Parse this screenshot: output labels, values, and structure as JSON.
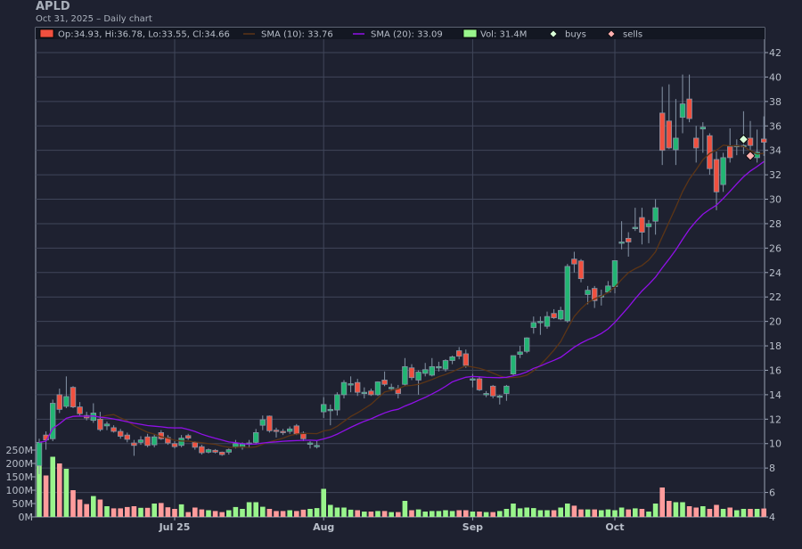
{
  "header": {
    "title": "APLD",
    "subtitle": "Oct 31, 2025 – Daily chart"
  },
  "legend": {
    "ohlc": "Op:34.93, Hi:36.78, Lo:33.55, Cl:34.66",
    "sma10": "SMA (10): 33.76",
    "sma20": "SMA (20): 33.09",
    "vol": "Vol: 31.4M",
    "buys": "buys",
    "sells": "sells"
  },
  "colors": {
    "up": "#22b573",
    "down": "#f0503f",
    "vol_up": "#99f58c",
    "vol_down": "#ff9c9c",
    "sma10": "#5c3516",
    "sma20": "#9010e8",
    "grid": "#40465a",
    "bg": "#1e2130",
    "buy": "#d9ffd9",
    "sell": "#ffb0b0"
  },
  "chart_data": {
    "type": "candlestick",
    "title": "APLD",
    "ylim": [
      4,
      42
    ],
    "y_ticks": [
      4,
      6,
      8,
      10,
      12,
      14,
      16,
      18,
      20,
      22,
      24,
      26,
      28,
      30,
      32,
      34,
      36,
      38,
      40,
      42
    ],
    "vol_ticks": [
      "0M",
      "50M",
      "100M",
      "150M",
      "200M",
      "250M"
    ],
    "vol_tick_values": [
      0,
      50,
      100,
      150,
      200,
      250
    ],
    "x_labels": [
      {
        "label": "Jul 25",
        "index": 20
      },
      {
        "label": "Aug",
        "index": 42
      },
      {
        "label": "Sep",
        "index": 64
      },
      {
        "label": "Oct",
        "index": 85
      }
    ],
    "sma_periods": [
      10,
      20
    ],
    "buys": [
      {
        "index": 104,
        "price": 34.9
      }
    ],
    "sells": [
      {
        "index": 105,
        "price": 33.55
      }
    ],
    "ohlcv": [
      [
        8.2,
        10.4,
        7.5,
        10.1,
        225
      ],
      [
        10.7,
        11.0,
        9.5,
        10.3,
        155
      ],
      [
        10.4,
        13.6,
        10.2,
        13.3,
        225
      ],
      [
        14.0,
        14.5,
        12.5,
        12.8,
        200
      ],
      [
        13.05,
        15.5,
        12.9,
        13.85,
        180
      ],
      [
        14.6,
        14.7,
        12.9,
        13.0,
        100
      ],
      [
        13.0,
        13.4,
        12.3,
        12.45,
        65
      ],
      [
        12.3,
        12.6,
        11.9,
        12.1,
        48
      ],
      [
        11.9,
        13.3,
        11.7,
        12.5,
        78
      ],
      [
        12.0,
        12.6,
        11.0,
        11.15,
        65
      ],
      [
        11.45,
        11.8,
        11.1,
        11.6,
        40
      ],
      [
        11.3,
        11.5,
        10.9,
        11.0,
        32
      ],
      [
        11.0,
        11.2,
        10.4,
        10.6,
        32
      ],
      [
        10.7,
        10.9,
        10.1,
        10.35,
        37
      ],
      [
        10.05,
        10.3,
        9.0,
        9.85,
        40
      ],
      [
        10.1,
        10.6,
        9.9,
        10.3,
        34
      ],
      [
        10.55,
        10.8,
        9.7,
        9.85,
        34
      ],
      [
        9.9,
        10.8,
        9.7,
        10.55,
        50
      ],
      [
        10.9,
        11.1,
        10.3,
        10.4,
        52
      ],
      [
        10.5,
        10.7,
        9.9,
        10.05,
        36
      ],
      [
        10.0,
        10.2,
        9.6,
        9.75,
        30
      ],
      [
        9.85,
        10.7,
        9.7,
        10.45,
        47
      ],
      [
        10.65,
        10.8,
        10.3,
        10.45,
        18
      ],
      [
        10.1,
        10.2,
        9.5,
        9.7,
        35
      ],
      [
        9.75,
        9.9,
        9.1,
        9.25,
        28
      ],
      [
        9.3,
        9.6,
        9.2,
        9.5,
        25
      ],
      [
        9.45,
        9.55,
        9.2,
        9.3,
        22
      ],
      [
        9.3,
        9.35,
        9.0,
        9.1,
        18
      ],
      [
        9.3,
        9.6,
        9.1,
        9.5,
        25
      ],
      [
        9.7,
        10.3,
        9.6,
        10.0,
        37
      ],
      [
        9.7,
        10.1,
        9.5,
        10.0,
        30
      ],
      [
        9.95,
        10.3,
        9.7,
        10.05,
        55
      ],
      [
        10.1,
        11.2,
        10.0,
        10.9,
        55
      ],
      [
        11.5,
        12.3,
        11.1,
        11.95,
        38
      ],
      [
        12.25,
        12.3,
        10.9,
        11.05,
        30
      ],
      [
        11.1,
        11.3,
        10.5,
        11.0,
        22
      ],
      [
        11.0,
        11.2,
        10.7,
        10.9,
        22
      ],
      [
        11.0,
        11.4,
        10.8,
        11.2,
        25
      ],
      [
        11.45,
        11.6,
        10.7,
        10.8,
        22
      ],
      [
        10.85,
        11.0,
        10.2,
        10.4,
        27
      ],
      [
        10.0,
        10.2,
        9.6,
        10.05,
        30
      ],
      [
        9.85,
        10.2,
        9.6,
        9.85,
        33
      ],
      [
        12.6,
        13.8,
        12.1,
        13.2,
        105
      ],
      [
        12.8,
        13.2,
        11.5,
        12.8,
        45
      ],
      [
        12.75,
        14.2,
        12.3,
        14.0,
        35
      ],
      [
        14.0,
        15.2,
        13.7,
        15.0,
        35
      ],
      [
        14.9,
        15.5,
        14.2,
        14.9,
        27
      ],
      [
        15.0,
        15.3,
        13.9,
        14.2,
        25
      ],
      [
        14.2,
        14.6,
        13.7,
        14.2,
        20
      ],
      [
        14.3,
        14.5,
        13.9,
        14.0,
        20
      ],
      [
        14.0,
        15.1,
        13.9,
        15.05,
        22
      ],
      [
        15.2,
        15.9,
        14.7,
        14.85,
        22
      ],
      [
        14.6,
        14.9,
        14.3,
        14.6,
        18
      ],
      [
        14.5,
        14.8,
        13.7,
        14.1,
        18
      ],
      [
        14.85,
        17.0,
        14.7,
        16.3,
        60
      ],
      [
        16.2,
        16.5,
        15.2,
        15.4,
        25
      ],
      [
        15.2,
        16.0,
        14.0,
        15.85,
        28
      ],
      [
        15.75,
        16.6,
        15.5,
        16.05,
        20
      ],
      [
        15.6,
        17.0,
        15.5,
        16.3,
        22
      ],
      [
        16.3,
        16.7,
        15.9,
        16.3,
        22
      ],
      [
        16.1,
        16.9,
        15.9,
        16.8,
        25
      ],
      [
        16.8,
        17.2,
        16.5,
        17.1,
        22
      ],
      [
        17.6,
        17.9,
        16.9,
        17.15,
        25
      ],
      [
        17.35,
        17.7,
        16.2,
        16.4,
        25
      ],
      [
        15.2,
        15.7,
        14.6,
        15.3,
        20
      ],
      [
        15.3,
        15.5,
        14.3,
        14.4,
        20
      ],
      [
        14.1,
        14.3,
        13.8,
        14.1,
        18
      ],
      [
        14.7,
        14.8,
        13.7,
        13.9,
        18
      ],
      [
        13.9,
        14.0,
        13.2,
        13.9,
        22
      ],
      [
        14.1,
        14.8,
        13.5,
        14.7,
        30
      ],
      [
        15.7,
        17.2,
        15.6,
        17.2,
        50
      ],
      [
        17.3,
        18.0,
        17.0,
        17.5,
        32
      ],
      [
        17.55,
        18.7,
        17.4,
        18.65,
        35
      ],
      [
        19.5,
        20.4,
        19.0,
        19.9,
        33
      ],
      [
        19.9,
        20.4,
        18.9,
        20.0,
        25
      ],
      [
        19.6,
        20.8,
        19.4,
        20.4,
        25
      ],
      [
        20.65,
        21.0,
        20.2,
        20.3,
        25
      ],
      [
        20.2,
        21.2,
        20.1,
        20.9,
        35
      ],
      [
        20.05,
        24.7,
        19.9,
        24.5,
        50
      ],
      [
        25.1,
        25.7,
        24.0,
        24.7,
        42
      ],
      [
        24.95,
        25.1,
        23.2,
        23.5,
        28
      ],
      [
        22.2,
        22.9,
        21.4,
        22.55,
        28
      ],
      [
        22.7,
        22.9,
        21.1,
        21.7,
        28
      ],
      [
        22.1,
        22.6,
        21.3,
        22.1,
        25
      ],
      [
        22.4,
        23.3,
        22.3,
        22.9,
        28
      ],
      [
        22.85,
        25.0,
        22.3,
        24.97,
        25
      ],
      [
        26.4,
        28.2,
        25.9,
        26.5,
        35
      ],
      [
        26.8,
        27.3,
        25.3,
        26.5,
        28
      ],
      [
        27.7,
        29.3,
        27.4,
        27.7,
        32
      ],
      [
        28.5,
        29.3,
        26.3,
        27.3,
        30
      ],
      [
        27.75,
        28.3,
        26.4,
        28.0,
        20
      ],
      [
        28.2,
        30.0,
        27.1,
        29.3,
        50
      ],
      [
        37.05,
        39.2,
        32.8,
        34.0,
        110
      ],
      [
        36.4,
        39.4,
        34.1,
        34.2,
        60
      ],
      [
        34.05,
        38.2,
        32.8,
        35.0,
        55
      ],
      [
        36.7,
        40.2,
        35.4,
        37.8,
        55
      ],
      [
        38.2,
        40.2,
        36.3,
        36.6,
        40
      ],
      [
        35.0,
        36.0,
        33.0,
        34.2,
        35
      ],
      [
        35.75,
        36.3,
        33.8,
        35.9,
        40
      ],
      [
        35.2,
        35.4,
        32.0,
        32.5,
        30
      ],
      [
        33.25,
        33.9,
        29.1,
        30.6,
        45
      ],
      [
        31.2,
        33.8,
        30.6,
        33.4,
        30
      ],
      [
        34.3,
        35.8,
        33.0,
        33.4,
        35
      ],
      [
        34.4,
        34.9,
        33.6,
        34.4,
        25
      ],
      [
        34.3,
        37.2,
        33.7,
        34.4,
        30
      ],
      [
        35.0,
        36.4,
        33.2,
        34.4,
        30
      ],
      [
        33.4,
        35.7,
        33.0,
        33.85,
        30
      ],
      [
        34.93,
        36.78,
        33.55,
        34.66,
        31.4
      ]
    ]
  }
}
